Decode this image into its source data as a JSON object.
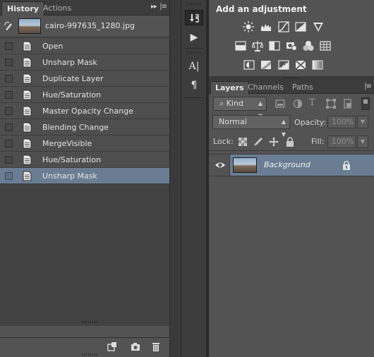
{
  "history_panel": {
    "tabs": [
      "History",
      "Actions"
    ],
    "snapshot_label": "cairo-997635_1280.jpg",
    "states": [
      {
        "label": "Open",
        "selected": false
      },
      {
        "label": "Unsharp Mask",
        "selected": false
      },
      {
        "label": "Duplicate Layer",
        "selected": false
      },
      {
        "label": "Hue/Saturation",
        "selected": false
      },
      {
        "label": "Master Opacity Change",
        "selected": false
      },
      {
        "label": "Blending Change",
        "selected": false
      },
      {
        "label": "MergeVisible",
        "selected": false
      },
      {
        "label": "Hue/Saturation",
        "selected": false
      },
      {
        "label": "Unsharp Mask",
        "selected": true
      }
    ],
    "footer_icons": [
      "new-document-from-state-icon",
      "camera-icon",
      "trash-icon"
    ]
  },
  "tool_strip": {
    "icons": [
      "history-brush-icon",
      "play-action-icon",
      "character-icon",
      "paragraph-icon"
    ]
  },
  "adjustments_panel": {
    "title": "Add an adjustment",
    "icons_row1": [
      "brightness-contrast-icon",
      "levels-icon",
      "curves-icon",
      "exposure-icon",
      "gradient-triangle-icon"
    ],
    "icons_row2": [
      "vibrance-icon",
      "balance-icon",
      "black-white-icon",
      "camera-filter-icon",
      "channel-mixer-icon",
      "color-lookup-icon"
    ],
    "icons_row3": [
      "invert-icon",
      "posterize-icon",
      "threshold-icon",
      "selective-color-icon",
      "gradient-map-icon"
    ]
  },
  "layers_panel": {
    "tabs": [
      "Layers",
      "Channels",
      "Paths"
    ],
    "filter_kind": "Kind",
    "blend_mode": "Normal",
    "opacity_label": "Opacity:",
    "opacity_value": "100%",
    "lock_label": "Lock:",
    "fill_label": "Fill:",
    "fill_value": "100%",
    "layers": [
      {
        "name": "Background",
        "visible": true,
        "locked": true,
        "selected": true
      }
    ]
  },
  "colors": {
    "selection": "#6a7d92",
    "panel": "#535353",
    "panel_dark": "#3c3c3c"
  }
}
